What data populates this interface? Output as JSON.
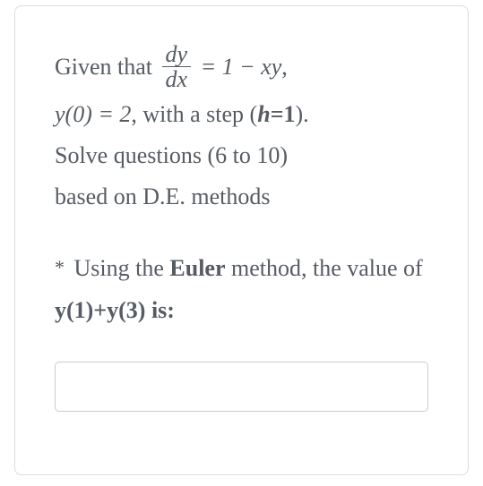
{
  "context": {
    "given_prefix": "Given that ",
    "frac_num": "dy",
    "frac_den": "dx",
    "equals": " = 1 − ",
    "rhs_var": "xy",
    "comma": ",",
    "ic_lhs": "y(0) = 2",
    "ic_rest": ", with a step (",
    "step_var": "h",
    "step_eq": "=",
    "step_val": "1",
    "step_close": ").",
    "line3a": "Solve questions (6 to 10)",
    "line4a": "based on D.E. methods"
  },
  "question": {
    "star": "*",
    "pre": " Using the ",
    "method": "Euler",
    "mid": " method, the value of ",
    "target": "y(1)+y(3) is:"
  },
  "answer": {
    "value": "",
    "placeholder": ""
  }
}
